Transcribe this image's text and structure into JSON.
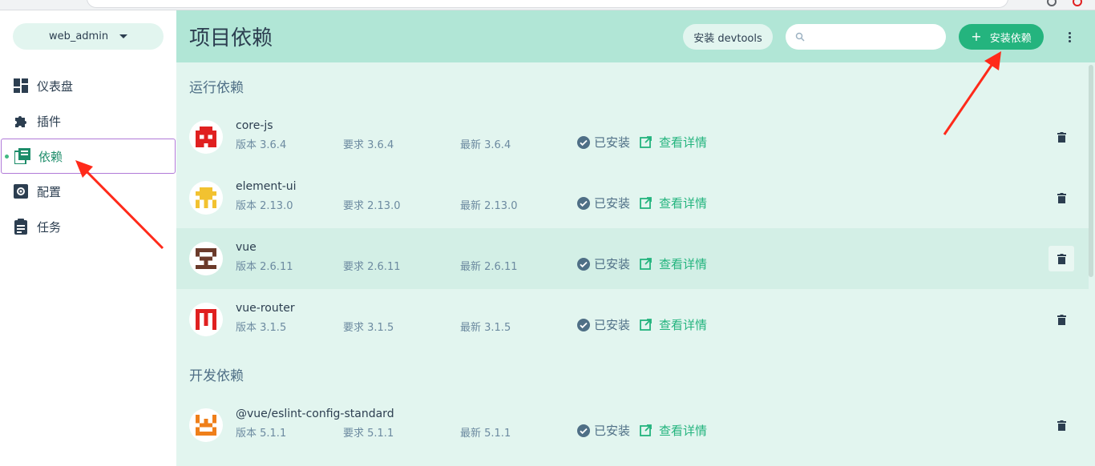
{
  "project": {
    "name": "web_admin"
  },
  "sidebar": {
    "items": [
      {
        "label": "仪表盘",
        "icon": "dashboard-icon",
        "active": false
      },
      {
        "label": "插件",
        "icon": "puzzle-icon",
        "active": false
      },
      {
        "label": "依赖",
        "icon": "library-books-icon",
        "active": true
      },
      {
        "label": "配置",
        "icon": "settings-box-icon",
        "active": false
      },
      {
        "label": "任务",
        "icon": "clipboard-icon",
        "active": false
      }
    ]
  },
  "header": {
    "title": "项目依赖",
    "devtools_label": "安装 devtools",
    "search": {
      "placeholder": "",
      "value": ""
    },
    "install_label": "安装依赖"
  },
  "sections": [
    {
      "title": "运行依赖",
      "deps": [
        {
          "name": "core-js",
          "version": "版本 3.6.4",
          "wanted": "要求 3.6.4",
          "latest": "最新 3.6.4",
          "status": "已安装",
          "details": "查看详情",
          "avatar_color": "#e02020"
        },
        {
          "name": "element-ui",
          "version": "版本 2.13.0",
          "wanted": "要求 2.13.0",
          "latest": "最新 2.13.0",
          "status": "已安装",
          "details": "查看详情",
          "avatar_color": "#f2c230"
        },
        {
          "name": "vue",
          "version": "版本 2.6.11",
          "wanted": "要求 2.6.11",
          "latest": "最新 2.6.11",
          "status": "已安装",
          "details": "查看详情",
          "avatar_color": "#6b3a2a"
        },
        {
          "name": "vue-router",
          "version": "版本 3.1.5",
          "wanted": "要求 3.1.5",
          "latest": "最新 3.1.5",
          "status": "已安装",
          "details": "查看详情",
          "avatar_color": "#e02020"
        }
      ]
    },
    {
      "title": "开发依赖",
      "deps": [
        {
          "name": "@vue/eslint-config-standard",
          "version": "版本 5.1.1",
          "wanted": "要求 5.1.1",
          "latest": "最新 5.1.1",
          "status": "已安装",
          "details": "查看详情",
          "avatar_color": "#ef7f1a"
        }
      ]
    }
  ],
  "colors": {
    "accent": "#24b47e",
    "header_bg": "#b1e6d6",
    "main_bg": "#e2f5ef",
    "annotation_red": "#ff2a1a"
  }
}
